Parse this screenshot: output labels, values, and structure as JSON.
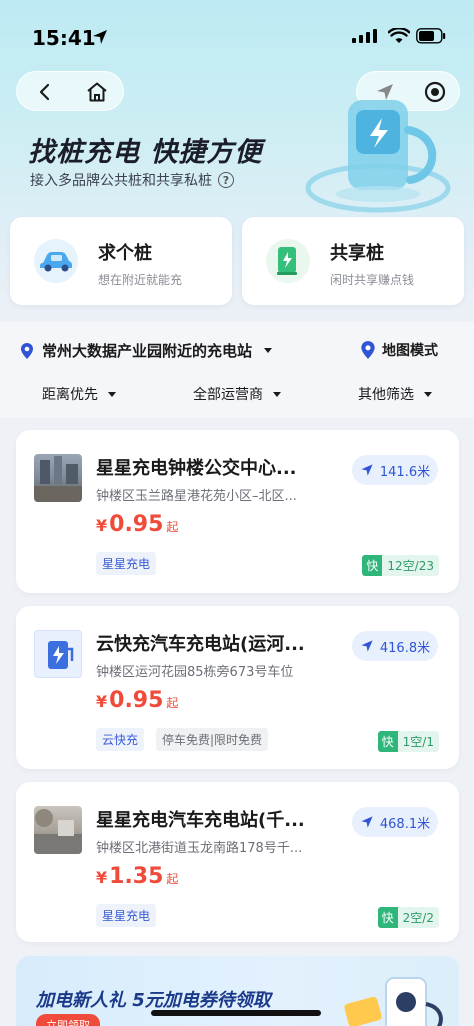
{
  "status": {
    "time": "15:41"
  },
  "nav": {
    "back_icon": "chevron-left-icon",
    "home_icon": "home-icon",
    "navigate_icon": "navigation-arrow-icon",
    "close_icon": "record-icon"
  },
  "hero": {
    "title": "找桩充电 快捷方便",
    "subtitle": "接入多品牌公共桩和共享私桩"
  },
  "entries": [
    {
      "title": "求个桩",
      "subtitle": "想在附近就能充",
      "icon": "car-icon"
    },
    {
      "title": "共享桩",
      "subtitle": "闲时共享赚点钱",
      "icon": "charger-icon"
    }
  ],
  "location": {
    "label": "常州大数据产业园附近的充电站",
    "map_mode": "地图模式"
  },
  "filters": [
    "距离优先",
    "全部运营商",
    "其他筛选"
  ],
  "stations": [
    {
      "name": "星星充电钟楼公交中心...",
      "address": "钟楼区玉兰路星港花苑小区–北区...",
      "currency": "¥",
      "price": "0.95",
      "price_suffix": "起",
      "tags": [
        "星星充电"
      ],
      "distance": "141.6米",
      "fast_label": "快",
      "availability": "12空/23"
    },
    {
      "name": "云快充汽车充电站(运河...",
      "address": "钟楼区运河花园85栋旁673号车位",
      "currency": "¥",
      "price": "0.95",
      "price_suffix": "起",
      "tags": [
        "云快充",
        "停车免费|限时免费"
      ],
      "distance": "416.8米",
      "fast_label": "快",
      "availability": "1空/1"
    },
    {
      "name": "星星充电汽车充电站(千...",
      "address": "钟楼区北港街道玉龙南路178号千...",
      "currency": "¥",
      "price": "1.35",
      "price_suffix": "起",
      "tags": [
        "星星充电"
      ],
      "distance": "468.1米",
      "fast_label": "快",
      "availability": "2空/2"
    }
  ],
  "promo": {
    "title": "加电新人礼 5元加电券待领取",
    "button": "立即领取"
  },
  "colors": {
    "accent": "#2f55d4",
    "price": "#f04a3a",
    "fast": "#2fb67a"
  }
}
